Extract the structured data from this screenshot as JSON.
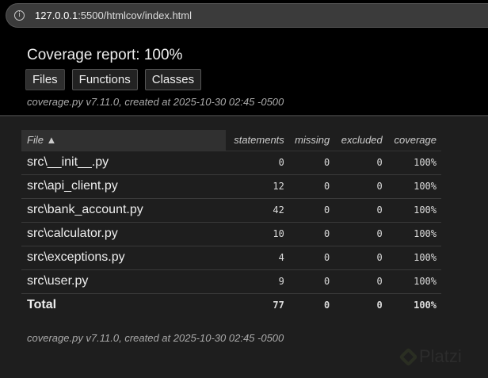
{
  "browser": {
    "url_host": "127.0.0.1",
    "url_rest": ":5500/htmlcov/index.html"
  },
  "header": {
    "title": "Coverage report: 100%",
    "tabs": [
      "Files",
      "Functions",
      "Classes"
    ],
    "meta": "coverage.py v7.11.0, created at 2025-10-30 02:45 -0500"
  },
  "table": {
    "columns": [
      "File ▲",
      "statements",
      "missing",
      "excluded",
      "coverage"
    ],
    "rows": [
      {
        "file": "src\\__init__.py",
        "statements": "0",
        "missing": "0",
        "excluded": "0",
        "coverage": "100%"
      },
      {
        "file": "src\\api_client.py",
        "statements": "12",
        "missing": "0",
        "excluded": "0",
        "coverage": "100%"
      },
      {
        "file": "src\\bank_account.py",
        "statements": "42",
        "missing": "0",
        "excluded": "0",
        "coverage": "100%"
      },
      {
        "file": "src\\calculator.py",
        "statements": "10",
        "missing": "0",
        "excluded": "0",
        "coverage": "100%"
      },
      {
        "file": "src\\exceptions.py",
        "statements": "4",
        "missing": "0",
        "excluded": "0",
        "coverage": "100%"
      },
      {
        "file": "src\\user.py",
        "statements": "9",
        "missing": "0",
        "excluded": "0",
        "coverage": "100%"
      }
    ],
    "total": {
      "file": "Total",
      "statements": "77",
      "missing": "0",
      "excluded": "0",
      "coverage": "100%"
    }
  },
  "footer": {
    "meta": "coverage.py v7.11.0, created at 2025-10-30 02:45 -0500"
  },
  "watermark": "Platzi"
}
